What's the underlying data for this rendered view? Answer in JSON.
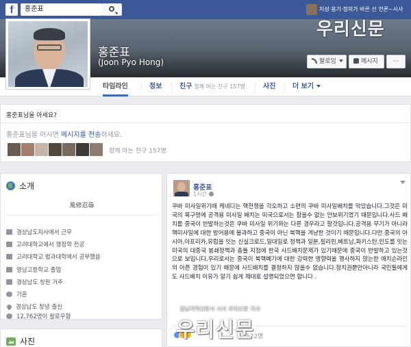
{
  "topbar": {
    "logo": "f",
    "search_value": "홍준표",
    "top_caption": "지성·용기·정의가 바른 선 언론~시사"
  },
  "watermark": {
    "text": "우리신문",
    "subtext": "경남지역신문사 시사 우리신문 지사"
  },
  "profile": {
    "name": "홍준표",
    "alt_name": "(Joon Pyo Hong)",
    "buttons": {
      "follow": "팔로잉",
      "message": "메시지",
      "more": "···"
    }
  },
  "tabs": [
    {
      "label": "타임라인",
      "sub": ""
    },
    {
      "label": "정보",
      "sub": ""
    },
    {
      "label": "친구",
      "sub": "함께 아는 친구 157명"
    },
    {
      "label": "사진",
      "sub": ""
    },
    {
      "label": "더 보기",
      "sub": ""
    }
  ],
  "know": {
    "title": "홍준표님을 아세요?",
    "text_prefix": "홍준표님을 아시면 ",
    "text_link": "메시지를 전송",
    "text_suffix": "하세요.",
    "mutual": "함께 아는 친구 157명",
    "avatar_colors": [
      "#6b5a4e",
      "#a67d6b",
      "#c9b5a5",
      "#55483f",
      "#7a6a5e",
      "#3e3a36",
      "#8c7b6e"
    ]
  },
  "intro": {
    "title": "소개",
    "quote": "風修忍辱",
    "items": [
      "경상남도지사에서 근무",
      "고려대학교에서 행정학 전공",
      "고려대학교 법과대학에서 공부했음",
      "영남고등학교 졸업",
      "경상남도 창원 거주",
      "기혼",
      "경상남도 창녕 출신",
      "12,762명이 팔로우함"
    ]
  },
  "photos": {
    "title": "사진"
  },
  "post": {
    "author": "홍준표",
    "time": "1시간",
    "body": "쿠바 미사일위기때 케네디는 핵전쟁을 각오하고 소련의 쿠바 미사일배치를 막았습니다.그것은 미국의 목구멍에 공격용 미사일 배치는 미국으로서는 참을수 없는 안보위기였기 때문입니다.사드 배치를 중국이 반발하는것은 쿠바 미사일 위기와는 다른 경우라고 할것입니다.공격용 무기가 아니라 핵미사일에 대한 방어용에 불과하고 중국이 아닌 북핵을 겨냥한 것이기 때문입니다.다만 중국의 아시아,아프리카,유럽을 잇는 신실크로드,일대일로 정책과 일본,필리핀,베트남,파키스탄,인도를 잇는 미국의 대중국 봉쇄정책과 충돌 지점에 한국 사드배치문제가 있기때문에 중국이 반발하고 있는것으로 보입니다.우리로서는 중국이 북핵폐기에 대한 강력한 영향력을 행사하지 않는한 애치슨라인의 아픈 경험이 있기 때문에 사드배치를 결정하지 않을수 없습니다.정치권뿐만아니라 국민들에게도 사드배치 이유가 알기 쉽게 제대로 설명되었으면 합니다 .",
    "reaction_count": "122명"
  }
}
